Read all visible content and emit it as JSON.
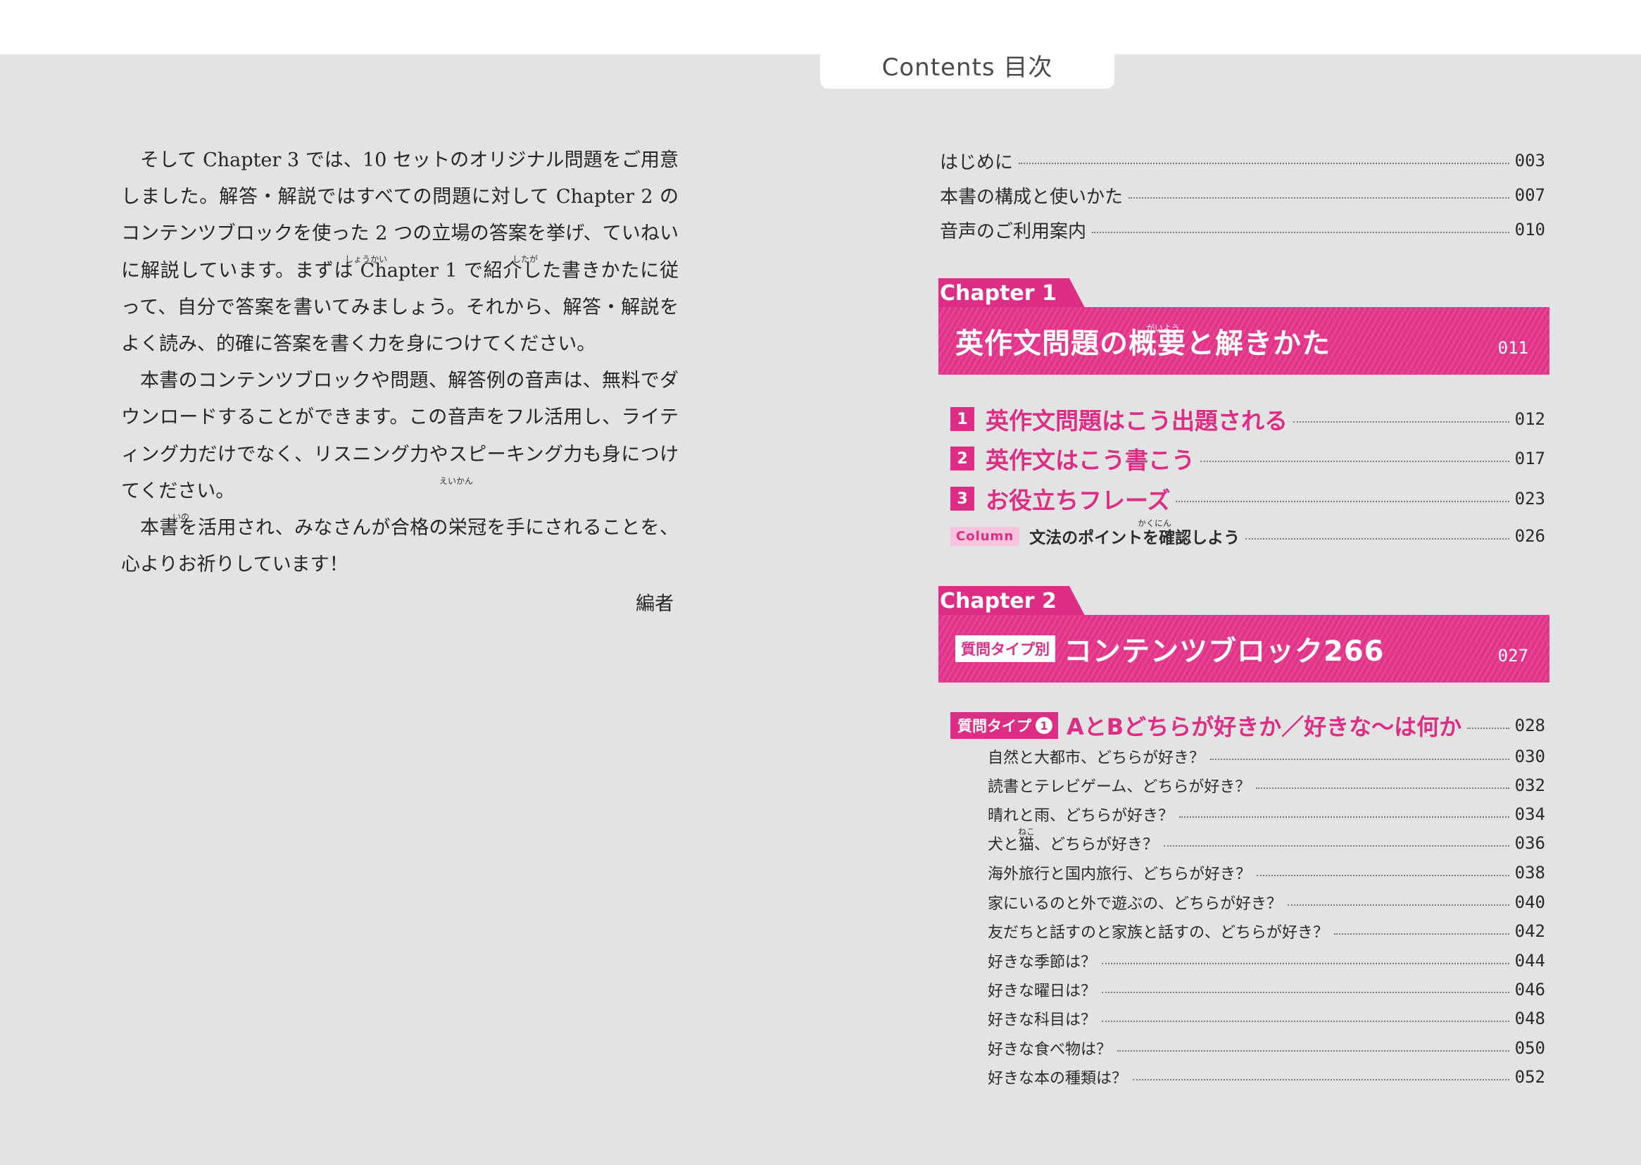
{
  "header": {
    "tab_title": "Contents 目次"
  },
  "left_page": {
    "paragraphs": [
      "そして Chapter 3 では、10 セットのオリジナル問題をご用意しました。解答・解説ではすべての問題に対して Chapter 2 のコンテンツブロックを使った 2 つの立場の答案を挙げ、ていねいに解説しています。まずは Chapter 1 で紹介した書きかたに従って、自分で答案を書いてみましょう。それから、解答・解説をよく読み、的確に答案を書く力を身につけてください。",
      "本書のコンテンツブロックや問題、解答例の音声は、無料でダウンロードすることができます。この音声をフル活用し、ライティング力だけでなく、リスニング力やスピーキング力も身につけてください。",
      "本書を活用され、みなさんが合格の栄冠を手にされることを、心よりお祈りしています！"
    ],
    "signature": "編者",
    "ruby": {
      "shoukai": "しょうかい",
      "shitaga": "したが",
      "eikan": "えいかん",
      "ino": "いの"
    }
  },
  "toc": {
    "intro": [
      {
        "label": "はじめに",
        "page": "003"
      },
      {
        "label": "本書の構成と使いかた",
        "page": "007"
      },
      {
        "label": "音声のご利用案内",
        "page": "010"
      }
    ],
    "chapter1": {
      "tab": "Chapter 1",
      "title": "英作文問題の概要と解きかた",
      "title_ruby": "がいよう",
      "page": "011",
      "sections": [
        {
          "num": "1",
          "label": "英作文問題はこう出題される",
          "page": "012"
        },
        {
          "num": "2",
          "label": "英作文はこう書こう",
          "page": "017"
        },
        {
          "num": "3",
          "label": "お役立ちフレーズ",
          "page": "023"
        }
      ],
      "column": {
        "badge": "Column",
        "label": "文法のポイントを確認しよう",
        "ruby": "かくにん",
        "page": "026"
      }
    },
    "chapter2": {
      "tab": "Chapter 2",
      "badge": "質問タイプ別",
      "title": "コンテンツブロック266",
      "page": "027",
      "qtype": {
        "badge": "質問タイプ",
        "num": "1",
        "label": "AとBどちらが好きか／好きな〜は何か",
        "page": "028"
      },
      "items": [
        {
          "label": "自然と大都市、どちらが好き？",
          "page": "030"
        },
        {
          "label": "読書とテレビゲーム、どちらが好き？",
          "page": "032"
        },
        {
          "label": "晴れと雨、どちらが好き？",
          "page": "034"
        },
        {
          "label": "犬と猫、どちらが好き？",
          "page": "036"
        },
        {
          "label": "海外旅行と国内旅行、どちらが好き？",
          "page": "038"
        },
        {
          "label": "家にいるのと外で遊ぶの、どちらが好き？",
          "page": "040"
        },
        {
          "label": "友だちと話すのと家族と話すの、どちらが好き？",
          "page": "042"
        },
        {
          "label": "好きな季節は？",
          "page": "044"
        },
        {
          "label": "好きな曜日は？",
          "page": "046"
        },
        {
          "label": "好きな科目は？",
          "page": "048"
        },
        {
          "label": "好きな食べ物は？",
          "page": "050"
        },
        {
          "label": "好きな本の種類は？",
          "page": "052"
        }
      ],
      "neko_ruby": "ねこ"
    }
  },
  "colors": {
    "accent": "#dd2d84",
    "background": "#e3e3e3"
  }
}
